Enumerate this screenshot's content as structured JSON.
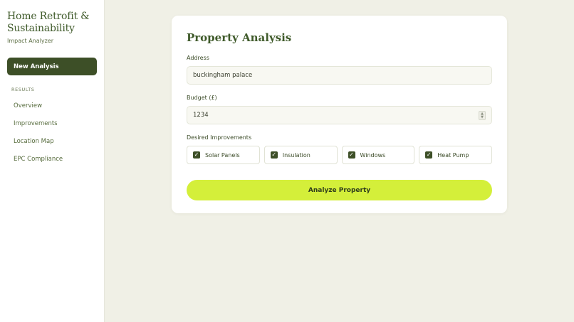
{
  "sidebar": {
    "title": "Home Retrofit & Sustainability",
    "subtitle": "Impact Analyzer",
    "primary_action": "New Analysis",
    "section_label": "RESULTS",
    "items": [
      {
        "label": "Overview"
      },
      {
        "label": "Improvements"
      },
      {
        "label": "Location Map"
      },
      {
        "label": "EPC Compliance"
      }
    ]
  },
  "form": {
    "title": "Property Analysis",
    "address_label": "Address",
    "address_value": "buckingham palace",
    "budget_label": "Budget (£)",
    "budget_value": "1234",
    "improvements_label": "Desired Improvements",
    "improvements": [
      {
        "label": "Solar Panels",
        "checked": true
      },
      {
        "label": "Insulation",
        "checked": true
      },
      {
        "label": "Windows",
        "checked": true
      },
      {
        "label": "Heat Pump",
        "checked": true
      }
    ],
    "submit_label": "Analyze Property"
  },
  "colors": {
    "accent": "#3d4f27",
    "cta": "#d4ef3a",
    "background": "#f0f0e6"
  },
  "icons": {
    "checkbox": "check-icon",
    "spinner": "number-spinner-icon"
  }
}
